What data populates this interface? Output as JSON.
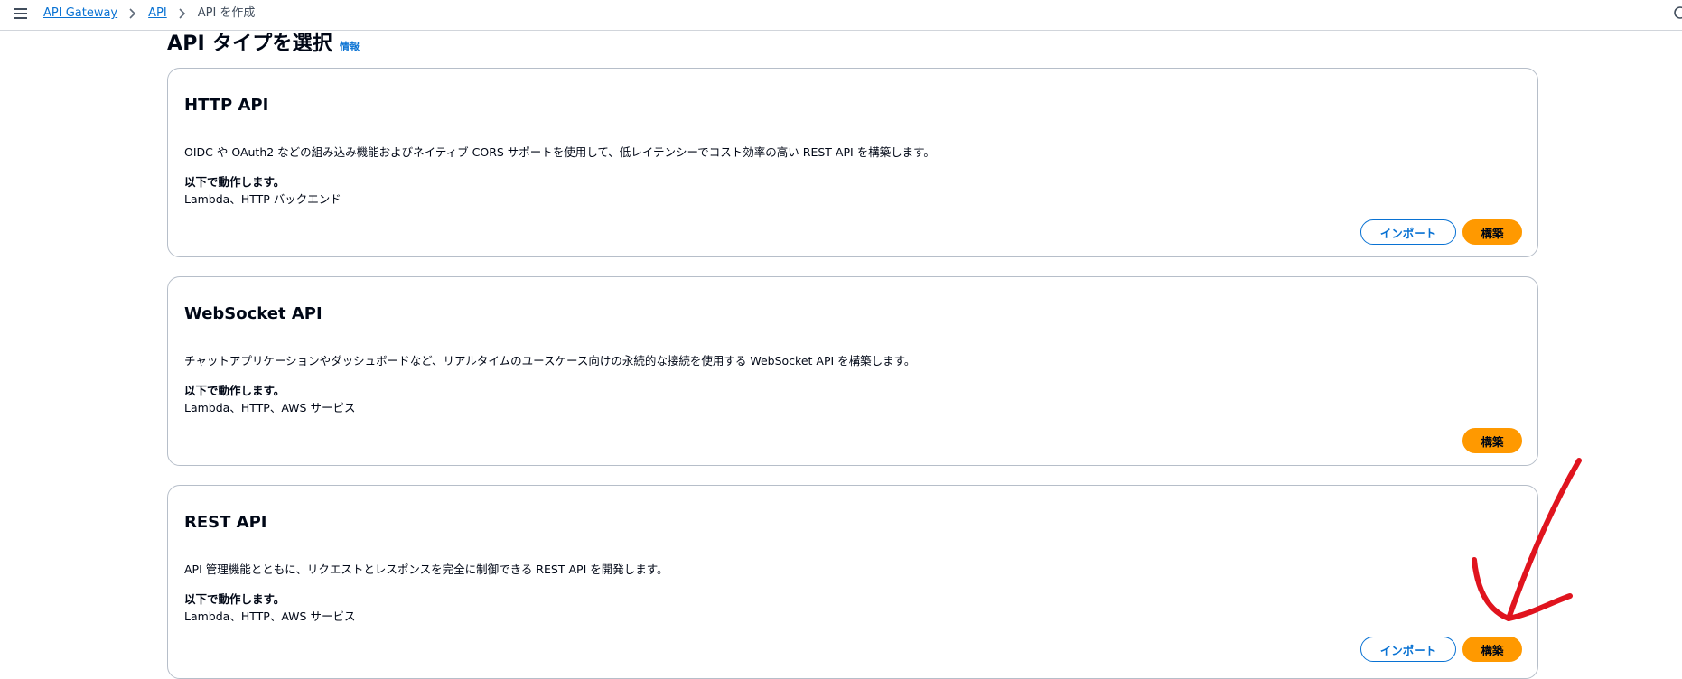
{
  "breadcrumb": {
    "items": [
      "API Gateway",
      "API"
    ],
    "current": "API を作成"
  },
  "section": {
    "title": "API タイプを選択",
    "info_label": "情報"
  },
  "cards": [
    {
      "title": "HTTP API",
      "description": "OIDC や OAuth2 などの組み込み機能およびネイティブ CORS サポートを使用して、低レイテンシーでコスト効率の高い REST API を構築します。",
      "works_with_label": "以下で動作します。",
      "works_with": "Lambda、HTTP バックエンド",
      "import_label": "インポート",
      "build_label": "構築"
    },
    {
      "title": "WebSocket API",
      "description": "チャットアプリケーションやダッシュボードなど、リアルタイムのユースケース向けの永続的な接続を使用する WebSocket API を構築します。",
      "works_with_label": "以下で動作します。",
      "works_with": "Lambda、HTTP、AWS サービス",
      "build_label": "構築"
    },
    {
      "title": "REST API",
      "description": "API 管理機能とともに、リクエストとレスポンスを完全に制御できる REST API を開発します。",
      "works_with_label": "以下で動作します。",
      "works_with": "Lambda、HTTP、AWS サービス",
      "import_label": "インポート",
      "build_label": "構築"
    }
  ],
  "colors": {
    "link": "#0972d3",
    "primary_button": "#ff9900",
    "annotation": "#e0141e"
  }
}
